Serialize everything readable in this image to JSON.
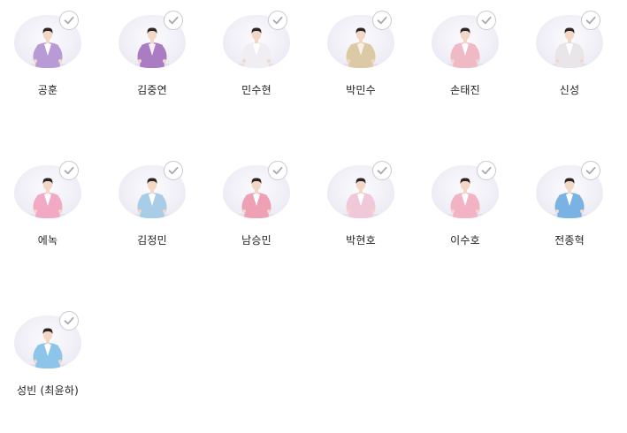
{
  "members": [
    {
      "name": "공훈",
      "suit": "#b79ad6",
      "shirt": "#ffffff",
      "selected": true
    },
    {
      "name": "김중연",
      "suit": "#a97cc4",
      "shirt": "#f4f0f6",
      "selected": true
    },
    {
      "name": "민수현",
      "suit": "#f1eef3",
      "shirt": "#ffffff",
      "selected": true
    },
    {
      "name": "박민수",
      "suit": "#dcc9a6",
      "shirt": "#f6f1e6",
      "selected": true
    },
    {
      "name": "손태진",
      "suit": "#f0b9c6",
      "shirt": "#ffffff",
      "selected": true
    },
    {
      "name": "신성",
      "suit": "#e9e6ea",
      "shirt": "#ffffff",
      "selected": true
    },
    {
      "name": "에녹",
      "suit": "#f2a9c4",
      "shirt": "#ffffff",
      "selected": true
    },
    {
      "name": "김정민",
      "suit": "#a9cde6",
      "shirt": "#ffffff",
      "selected": true
    },
    {
      "name": "남승민",
      "suit": "#eea0b5",
      "shirt": "#ffffff",
      "selected": true
    },
    {
      "name": "박현호",
      "suit": "#efc9d8",
      "shirt": "#ffffff",
      "selected": true
    },
    {
      "name": "이수호",
      "suit": "#f2b4c4",
      "shirt": "#ffffff",
      "selected": true
    },
    {
      "name": "전종혁",
      "suit": "#7ab3e3",
      "shirt": "#ffffff",
      "selected": true
    },
    {
      "name": "성빈 (최윤하)",
      "suit": "#8cc4ea",
      "shirt": "#ffffff",
      "selected": true
    }
  ],
  "colors": {
    "check_border": "#c9c9cf",
    "check_mark": "#a8a8ae",
    "name_text": "#222222",
    "background": "#ffffff"
  },
  "icons": {
    "check": "check-icon",
    "photo": "member-photo"
  }
}
